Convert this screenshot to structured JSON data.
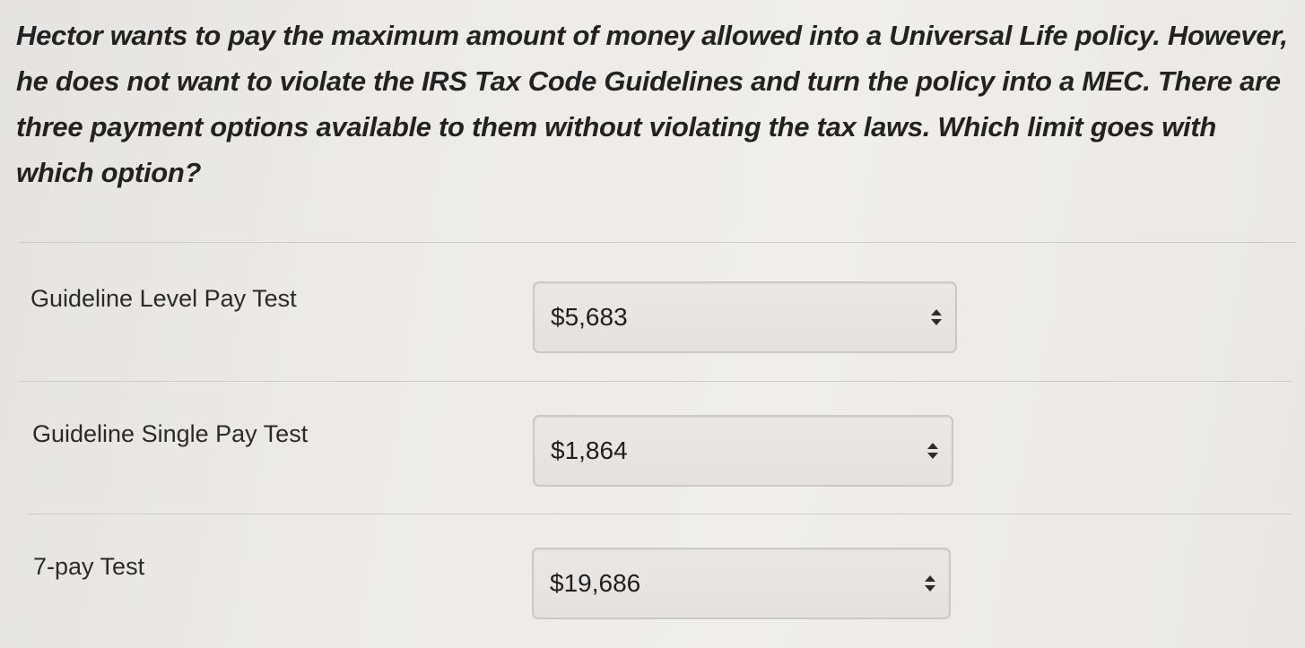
{
  "question": {
    "text": "Hector wants to pay the maximum amount of money allowed into a Universal Life policy. However, he does not want to violate the IRS Tax Code Guidelines and turn the policy into a MEC. There are three payment options available to them without violating the tax laws. Which limit goes with which option?"
  },
  "rows": [
    {
      "label": "Guideline Level Pay Test",
      "selected": "$5,683",
      "icon": "up-down-arrows-icon"
    },
    {
      "label": "Guideline Single Pay Test",
      "selected": "$1,864",
      "icon": "up-down-arrows-icon"
    },
    {
      "label": "7-pay Test",
      "selected": "$19,686",
      "icon": "up-down-arrows-icon"
    }
  ],
  "colors": {
    "background": "#ecebe9",
    "text": "#222222",
    "select_border": "#cbc9c6",
    "divider": "#cfcdca"
  }
}
